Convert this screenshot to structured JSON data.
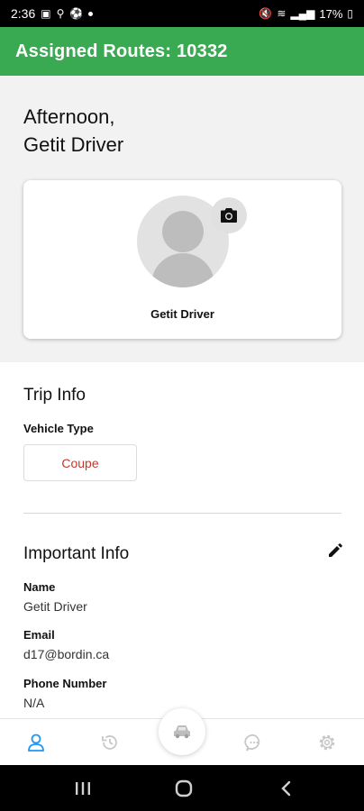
{
  "status_bar": {
    "time": "2:36",
    "battery": "17%"
  },
  "app_bar": {
    "title": "Assigned Routes: 10332"
  },
  "greeting": {
    "line1": "Afternoon,",
    "line2": "Getit Driver"
  },
  "profile": {
    "name": "Getit Driver"
  },
  "trip_info": {
    "title": "Trip Info",
    "vehicle_type_label": "Vehicle Type",
    "vehicle_type_value": "Coupe"
  },
  "important_info": {
    "title": "Important Info",
    "fields": [
      {
        "label": "Name",
        "value": "Getit Driver"
      },
      {
        "label": "Email",
        "value": "d17@bordin.ca"
      },
      {
        "label": "Phone Number",
        "value": "N/A"
      }
    ]
  },
  "colors": {
    "accent_green": "#3aaa52",
    "active_blue": "#2196f3",
    "vehicle_red": "#c0392b"
  },
  "icons": {
    "app_bar": [],
    "profile": [
      "camera-icon"
    ],
    "important_info": [
      "edit-icon"
    ],
    "bottom_nav": [
      "profile-icon",
      "history-icon",
      "car-icon",
      "chat-icon",
      "settings-icon"
    ],
    "system_nav": [
      "recents-icon",
      "home-icon",
      "back-icon"
    ]
  }
}
